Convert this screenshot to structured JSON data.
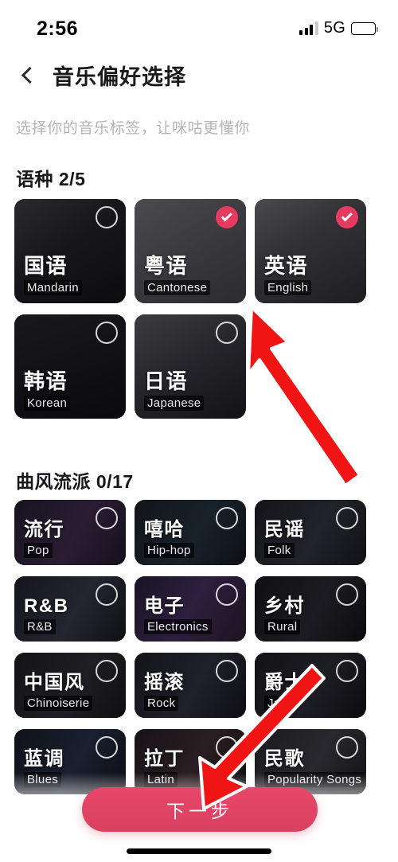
{
  "statusbar": {
    "time": "2:56",
    "network": "5G",
    "signal_icon": "signal-bars-icon",
    "battery_icon": "battery-full-icon"
  },
  "navbar": {
    "back_icon": "chevron-left-icon",
    "title": "音乐偏好选择"
  },
  "page": {
    "subtitle": "选择你的音乐标签，让咪咕更懂你"
  },
  "sections": [
    {
      "id": "language",
      "title": "语种",
      "count": "2/5",
      "items": [
        {
          "zh": "国语",
          "en": "Mandarin",
          "selected": false,
          "art": "portrait-dark"
        },
        {
          "zh": "粤语",
          "en": "Cantonese",
          "selected": true,
          "art": "album-gray"
        },
        {
          "zh": "英语",
          "en": "English",
          "selected": true,
          "art": "portrait-light"
        },
        {
          "zh": "韩语",
          "en": "Korean",
          "selected": false,
          "art": "logo-dark"
        },
        {
          "zh": "日语",
          "en": "Japanese",
          "selected": false,
          "art": "portrait-face"
        }
      ]
    },
    {
      "id": "genre",
      "title": "曲风流派",
      "count": "0/17",
      "items": [
        {
          "zh": "流行",
          "en": "Pop",
          "selected": false,
          "art": "stage-purple"
        },
        {
          "zh": "嘻哈",
          "en": "Hip-hop",
          "selected": false,
          "art": "stage-teal"
        },
        {
          "zh": "民谣",
          "en": "Folk",
          "selected": false,
          "art": "stage-gray"
        },
        {
          "zh": "R&B",
          "en": "R&B",
          "selected": false,
          "art": "portrait-blue"
        },
        {
          "zh": "电子",
          "en": "Electronics",
          "selected": false,
          "art": "stage-violet"
        },
        {
          "zh": "乡村",
          "en": "Rural",
          "selected": false,
          "art": "stage-dark"
        },
        {
          "zh": "中国风",
          "en": "Chinoiserie",
          "selected": false,
          "art": "stage-dim"
        },
        {
          "zh": "摇滚",
          "en": "Rock",
          "selected": false,
          "art": "crowd-dark"
        },
        {
          "zh": "爵士",
          "en": "Jazz",
          "selected": false,
          "art": "club-dark"
        },
        {
          "zh": "蓝调",
          "en": "Blues",
          "selected": false,
          "art": "stage-navy"
        },
        {
          "zh": "拉丁",
          "en": "Latin",
          "selected": false,
          "art": "stage-warm"
        },
        {
          "zh": "民歌",
          "en": "Popularity Songs",
          "selected": false,
          "art": "portrait-soft"
        }
      ]
    }
  ],
  "footer": {
    "next_label": "下一步"
  },
  "annotations": [
    {
      "name": "arrow-to-language-cards",
      "color": "#f01414"
    },
    {
      "name": "arrow-to-next-button",
      "color": "#f01414"
    }
  ],
  "colors": {
    "accent": "#e63a5e",
    "button": "#e8476a",
    "text": "#17171a",
    "muted": "#b4b4b9"
  }
}
